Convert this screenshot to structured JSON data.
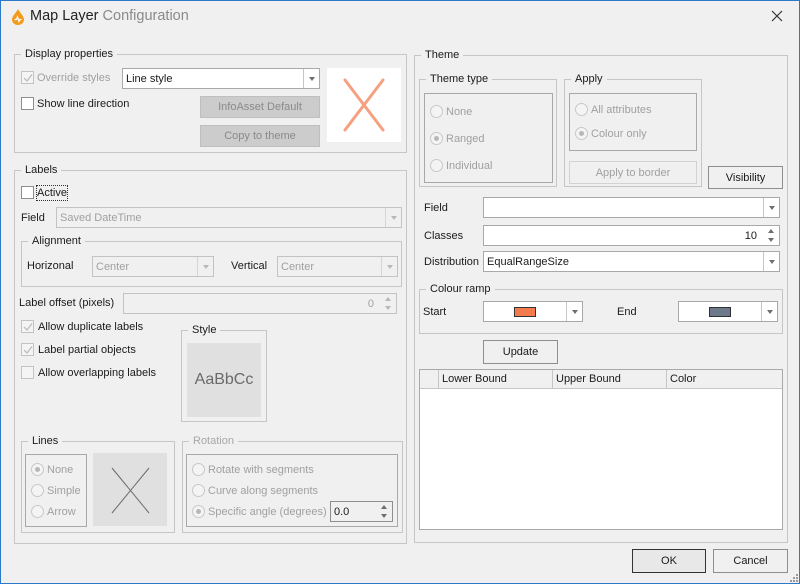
{
  "window": {
    "title_main": "Map Layer",
    "title_secondary": "Configuration",
    "app_icon": "flame-drop-icon",
    "close_icon": "close-icon",
    "accent_color": "#f29b1d"
  },
  "display_properties": {
    "title": "Display properties",
    "override_styles": {
      "label": "Override styles",
      "checked": true,
      "enabled": false
    },
    "style_select": {
      "value": "Line style"
    },
    "show_line_direction": {
      "label": "Show line direction",
      "checked": false
    },
    "infoasset_default_label": "InfoAsset Default",
    "copy_to_theme_label": "Copy to theme",
    "preview_color": "#f5a080"
  },
  "labels": {
    "title": "Labels",
    "active": {
      "label": "Active",
      "checked": false
    },
    "field_label": "Field",
    "field_value": "Saved DateTime",
    "alignment": {
      "title": "Alignment",
      "horizontal_label": "Horizonal",
      "horizontal_value": "Center",
      "vertical_label": "Vertical",
      "vertical_value": "Center"
    },
    "offset_label": "Label offset (pixels)",
    "offset_value": "0",
    "allow_duplicate": {
      "label": "Allow duplicate labels",
      "checked": true
    },
    "label_partial": {
      "label": "Label partial objects",
      "checked": true
    },
    "allow_overlapping": {
      "label": "Allow overlapping labels",
      "checked": false
    },
    "style": {
      "title": "Style",
      "sample": "AaBbCc"
    },
    "lines": {
      "title": "Lines",
      "options": [
        "None",
        "Simple",
        "Arrow"
      ],
      "selected": "None"
    },
    "rotation": {
      "title": "Rotation",
      "options": [
        "Rotate with segments",
        "Curve along segments",
        "Specific angle (degrees)"
      ],
      "selected": "Specific angle (degrees)",
      "angle_value": "0.0"
    }
  },
  "theme": {
    "title": "Theme",
    "theme_type": {
      "title": "Theme type",
      "options": [
        "None",
        "Ranged",
        "Individual"
      ],
      "selected": "Ranged"
    },
    "apply": {
      "title": "Apply",
      "options": [
        "All attributes",
        "Colour only"
      ],
      "selected": "Colour only",
      "apply_to_border_label": "Apply to border"
    },
    "visibility_label": "Visibility",
    "field_label": "Field",
    "field_value": "",
    "classes_label": "Classes",
    "classes_value": "10",
    "distribution_label": "Distribution",
    "distribution_value": "EqualRangeSize",
    "colour_ramp": {
      "title": "Colour ramp",
      "start_label": "Start",
      "start_color": "#f47b4e",
      "end_label": "End",
      "end_color": "#6d7a89"
    },
    "update_label": "Update",
    "grid": {
      "columns": [
        "",
        "Lower Bound",
        "Upper Bound",
        "Color"
      ],
      "rows": []
    }
  },
  "footer": {
    "ok_label": "OK",
    "cancel_label": "Cancel"
  }
}
